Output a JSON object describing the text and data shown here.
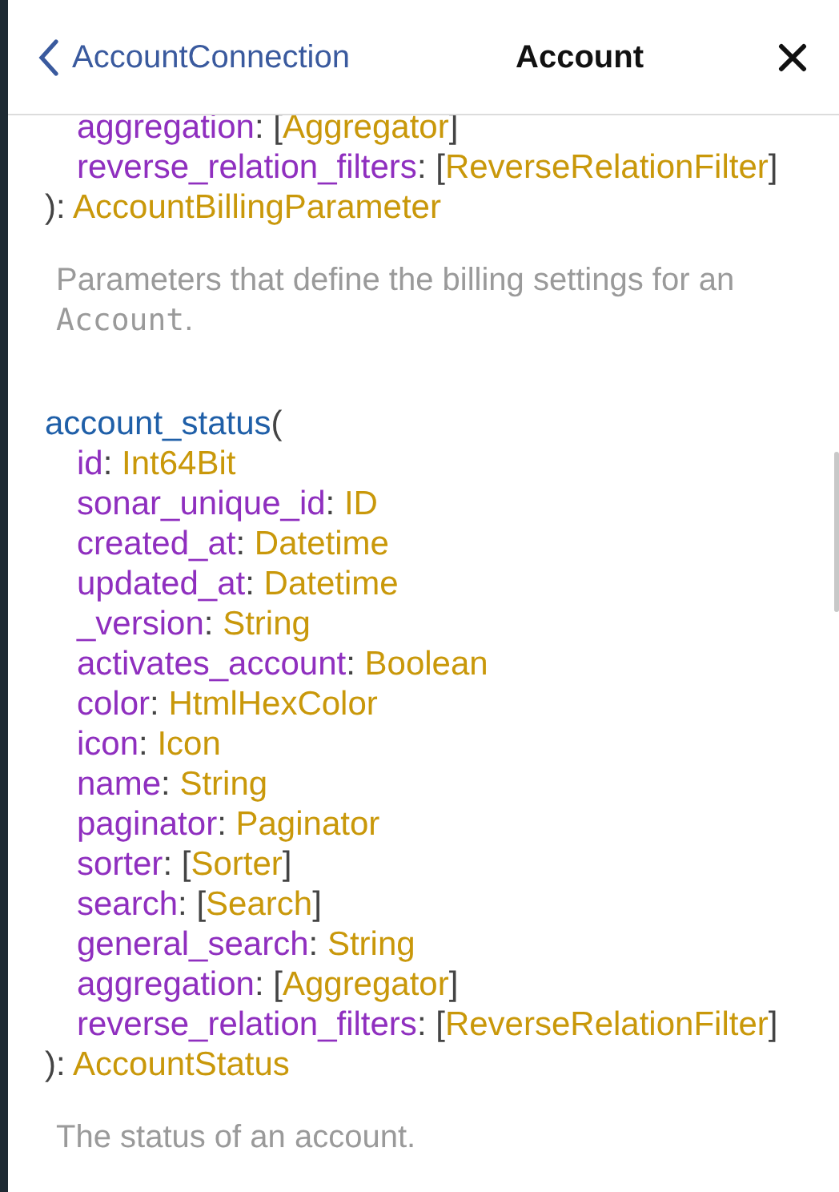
{
  "header": {
    "back_link": "AccountConnection",
    "title": "Account"
  },
  "blocks": [
    {
      "lines": [
        {
          "indent": true,
          "tokens": [
            {
              "kind": "name",
              "text": "aggregation"
            },
            {
              "kind": "punct",
              "text": ": ["
            },
            {
              "kind": "type",
              "text": "Aggregator"
            },
            {
              "kind": "punct",
              "text": "]"
            }
          ]
        },
        {
          "indent": true,
          "tokens": [
            {
              "kind": "name",
              "text": "reverse_relation_filters"
            },
            {
              "kind": "punct",
              "text": ": ["
            },
            {
              "kind": "type",
              "text": "ReverseRelationFilter"
            },
            {
              "kind": "punct",
              "text": "]"
            }
          ]
        },
        {
          "indent": false,
          "tokens": [
            {
              "kind": "punct",
              "text": "): "
            },
            {
              "kind": "type",
              "text": "AccountBillingParameter"
            }
          ]
        }
      ],
      "description": [
        {
          "kind": "text",
          "text": "Parameters that define the billing settings for an "
        },
        {
          "kind": "code",
          "text": "Account"
        },
        {
          "kind": "text",
          "text": "."
        }
      ]
    },
    {
      "lines": [
        {
          "indent": false,
          "tokens": [
            {
              "kind": "field",
              "text": "account_status"
            },
            {
              "kind": "punct",
              "text": "("
            }
          ]
        },
        {
          "indent": true,
          "tokens": [
            {
              "kind": "name",
              "text": "id"
            },
            {
              "kind": "punct",
              "text": ": "
            },
            {
              "kind": "type",
              "text": "Int64Bit"
            }
          ]
        },
        {
          "indent": true,
          "tokens": [
            {
              "kind": "name",
              "text": "sonar_unique_id"
            },
            {
              "kind": "punct",
              "text": ": "
            },
            {
              "kind": "type",
              "text": "ID"
            }
          ]
        },
        {
          "indent": true,
          "tokens": [
            {
              "kind": "name",
              "text": "created_at"
            },
            {
              "kind": "punct",
              "text": ": "
            },
            {
              "kind": "type",
              "text": "Datetime"
            }
          ]
        },
        {
          "indent": true,
          "tokens": [
            {
              "kind": "name",
              "text": "updated_at"
            },
            {
              "kind": "punct",
              "text": ": "
            },
            {
              "kind": "type",
              "text": "Datetime"
            }
          ]
        },
        {
          "indent": true,
          "tokens": [
            {
              "kind": "name",
              "text": "_version"
            },
            {
              "kind": "punct",
              "text": ": "
            },
            {
              "kind": "type",
              "text": "String"
            }
          ]
        },
        {
          "indent": true,
          "tokens": [
            {
              "kind": "name",
              "text": "activates_account"
            },
            {
              "kind": "punct",
              "text": ": "
            },
            {
              "kind": "type",
              "text": "Boolean"
            }
          ]
        },
        {
          "indent": true,
          "tokens": [
            {
              "kind": "name",
              "text": "color"
            },
            {
              "kind": "punct",
              "text": ": "
            },
            {
              "kind": "type",
              "text": "HtmlHexColor"
            }
          ]
        },
        {
          "indent": true,
          "tokens": [
            {
              "kind": "name",
              "text": "icon"
            },
            {
              "kind": "punct",
              "text": ": "
            },
            {
              "kind": "type",
              "text": "Icon"
            }
          ]
        },
        {
          "indent": true,
          "tokens": [
            {
              "kind": "name",
              "text": "name"
            },
            {
              "kind": "punct",
              "text": ": "
            },
            {
              "kind": "type",
              "text": "String"
            }
          ]
        },
        {
          "indent": true,
          "tokens": [
            {
              "kind": "name",
              "text": "paginator"
            },
            {
              "kind": "punct",
              "text": ": "
            },
            {
              "kind": "type",
              "text": "Paginator"
            }
          ]
        },
        {
          "indent": true,
          "tokens": [
            {
              "kind": "name",
              "text": "sorter"
            },
            {
              "kind": "punct",
              "text": ": ["
            },
            {
              "kind": "type",
              "text": "Sorter"
            },
            {
              "kind": "punct",
              "text": "]"
            }
          ]
        },
        {
          "indent": true,
          "tokens": [
            {
              "kind": "name",
              "text": "search"
            },
            {
              "kind": "punct",
              "text": ": ["
            },
            {
              "kind": "type",
              "text": "Search"
            },
            {
              "kind": "punct",
              "text": "]"
            }
          ]
        },
        {
          "indent": true,
          "tokens": [
            {
              "kind": "name",
              "text": "general_search"
            },
            {
              "kind": "punct",
              "text": ": "
            },
            {
              "kind": "type",
              "text": "String"
            }
          ]
        },
        {
          "indent": true,
          "tokens": [
            {
              "kind": "name",
              "text": "aggregation"
            },
            {
              "kind": "punct",
              "text": ": ["
            },
            {
              "kind": "type",
              "text": "Aggregator"
            },
            {
              "kind": "punct",
              "text": "]"
            }
          ]
        },
        {
          "indent": true,
          "tokens": [
            {
              "kind": "name",
              "text": "reverse_relation_filters"
            },
            {
              "kind": "punct",
              "text": ": ["
            },
            {
              "kind": "type",
              "text": "ReverseRelationFilter"
            },
            {
              "kind": "punct",
              "text": "]"
            }
          ]
        },
        {
          "indent": false,
          "tokens": [
            {
              "kind": "punct",
              "text": "): "
            },
            {
              "kind": "type",
              "text": "AccountStatus"
            }
          ]
        }
      ],
      "description": [
        {
          "kind": "text",
          "text": "The status of an account."
        }
      ]
    }
  ]
}
